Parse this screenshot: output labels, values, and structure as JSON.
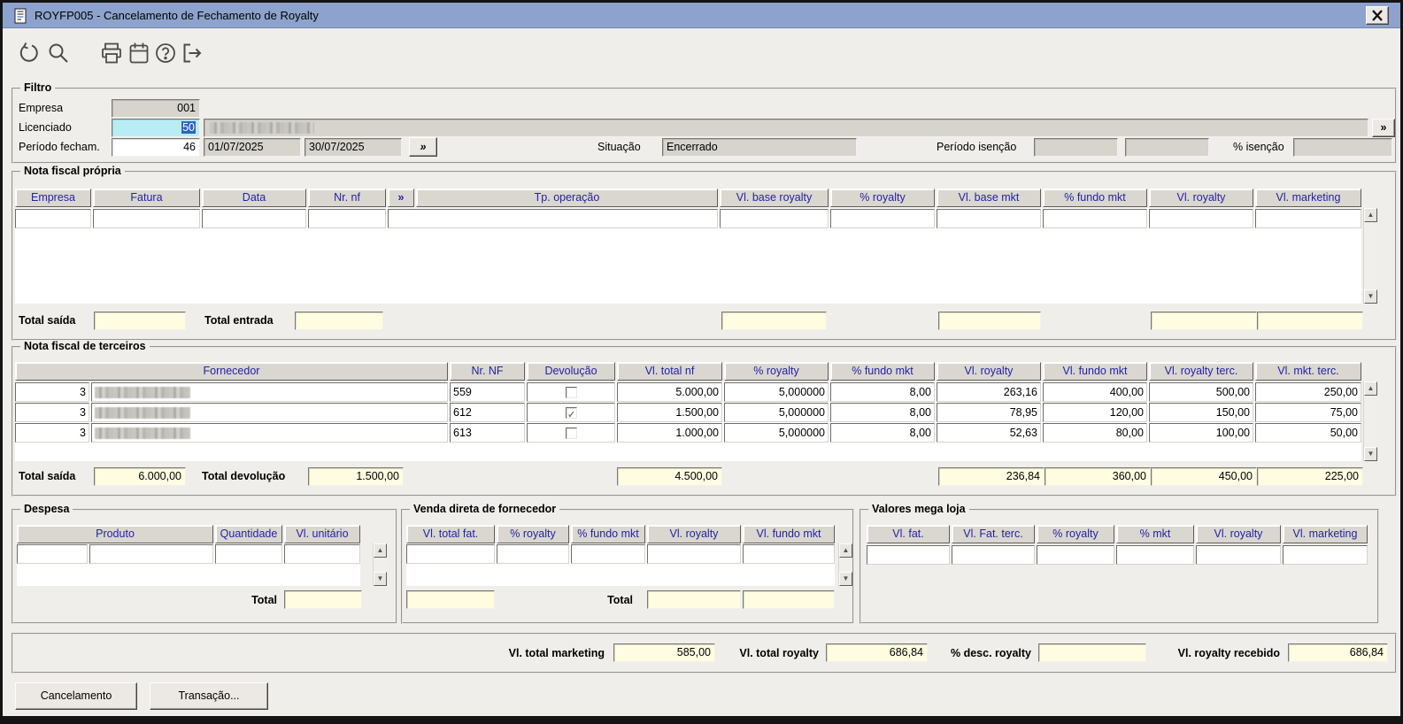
{
  "window": {
    "title": "ROYFP005 - Cancelamento de Fechamento de Royalty"
  },
  "toolbar": {
    "icons": [
      "undo",
      "search",
      "print",
      "calendar",
      "help",
      "exit"
    ]
  },
  "filtro": {
    "title": "Filtro",
    "empresa_label": "Empresa",
    "empresa": "001",
    "licenciado_label": "Licenciado",
    "licenciado_code": "50",
    "periodo_label": "Período fecham.",
    "periodo_code": "46",
    "periodo_inicio": "01/07/2025",
    "periodo_fim": "30/07/2025",
    "browse": "»",
    "situacao_label": "Situação",
    "situacao": "Encerrado",
    "periodo_isencao_label": "Período isenção",
    "periodo_isencao_inicio": "",
    "periodo_isencao_fim": "",
    "isencao_label": "% isenção",
    "isencao": ""
  },
  "nota_propria": {
    "title": "Nota fiscal própria",
    "columns": [
      "Empresa",
      "Fatura",
      "Data",
      "Nr. nf",
      "»",
      "Tp. operação",
      "Vl. base royalty",
      "% royalty",
      "Vl. base mkt",
      "% fundo mkt",
      "Vl. royalty",
      "Vl. marketing"
    ],
    "total_saida_label": "Total saída",
    "total_saida": "",
    "total_entrada_label": "Total entrada",
    "total_entrada": "",
    "total_base_royalty": "",
    "total_base_mkt": "",
    "total_royalty": "",
    "total_marketing": ""
  },
  "nota_terceiros": {
    "title": "Nota fiscal de terceiros",
    "columns": [
      "Fornecedor",
      "Nr. NF",
      "Devolução",
      "Vl. total nf",
      "% royalty",
      "% fundo mkt",
      "Vl. royalty",
      "Vl. fundo mkt",
      "Vl. royalty terc.",
      "Vl. mkt. terc."
    ],
    "rows": [
      {
        "codigo": "3",
        "nr_nf": "559",
        "devolucao": false,
        "vl_total_nf": "5.000,00",
        "pct_royalty": "5,000000",
        "pct_fundo_mkt": "8,00",
        "vl_royalty": "263,16",
        "vl_fundo_mkt": "400,00",
        "vl_royalty_terc": "500,00",
        "vl_mkt_terc": "250,00"
      },
      {
        "codigo": "3",
        "nr_nf": "612",
        "devolucao": true,
        "vl_total_nf": "1.500,00",
        "pct_royalty": "5,000000",
        "pct_fundo_mkt": "8,00",
        "vl_royalty": "78,95",
        "vl_fundo_mkt": "120,00",
        "vl_royalty_terc": "150,00",
        "vl_mkt_terc": "75,00"
      },
      {
        "codigo": "3",
        "nr_nf": "613",
        "devolucao": false,
        "vl_total_nf": "1.000,00",
        "pct_royalty": "5,000000",
        "pct_fundo_mkt": "8,00",
        "vl_royalty": "52,63",
        "vl_fundo_mkt": "80,00",
        "vl_royalty_terc": "100,00",
        "vl_mkt_terc": "50,00"
      }
    ],
    "total_saida_label": "Total saída",
    "total_saida": "6.000,00",
    "total_devolucao_label": "Total devolução",
    "total_devolucao": "1.500,00",
    "total_nf": "4.500,00",
    "total_royalty": "236,84",
    "total_fundo_mkt": "360,00",
    "total_royalty_terc": "450,00",
    "total_mkt_terc": "225,00"
  },
  "despesa": {
    "title": "Despesa",
    "columns": [
      "Produto",
      "Quantidade",
      "Vl. unitário"
    ],
    "total_label": "Total",
    "total": ""
  },
  "venda_direta": {
    "title": "Venda direta de fornecedor",
    "columns": [
      "Vl. total fat.",
      "% royalty",
      "% fundo mkt",
      "Vl. royalty",
      "Vl. fundo mkt"
    ],
    "total_label": "Total",
    "total_fat": "",
    "total_royalty": "",
    "total_fundo_mkt": ""
  },
  "mega_loja": {
    "title": "Valores mega loja",
    "columns": [
      "Vl. fat.",
      "Vl. Fat. terc.",
      "% royalty",
      "% mkt",
      "Vl. royalty",
      "Vl. marketing"
    ]
  },
  "summary": {
    "vl_total_marketing_label": "Vl. total marketing",
    "vl_total_marketing": "585,00",
    "vl_total_royalty_label": "Vl. total royalty",
    "vl_total_royalty": "686,84",
    "pct_desc_royalty_label": "% desc. royalty",
    "pct_desc_royalty": "",
    "vl_royalty_recebido_label": "Vl. royalty recebido",
    "vl_royalty_recebido": "686,84"
  },
  "buttons": {
    "cancelamento": "Cancelamento",
    "transacao": "Transação..."
  }
}
